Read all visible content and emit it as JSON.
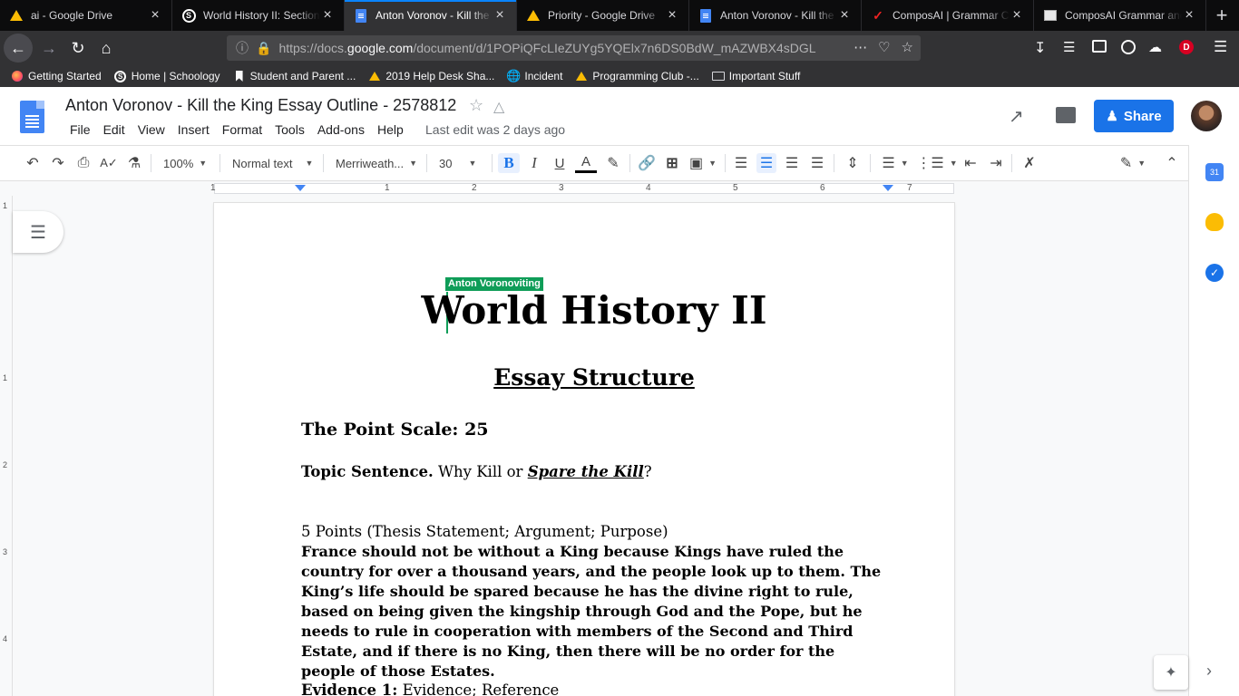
{
  "browser": {
    "tabs": [
      {
        "title": "ai - Google Drive",
        "icon": "google-drive-icon",
        "active": false
      },
      {
        "title": "World History II: Section",
        "icon": "schoology-icon",
        "active": false
      },
      {
        "title": "Anton Voronov - Kill the",
        "icon": "google-docs-icon",
        "active": true
      },
      {
        "title": "Priority - Google Drive",
        "icon": "google-drive-icon",
        "active": false
      },
      {
        "title": "Anton Voronov - Kill the",
        "icon": "google-docs-icon",
        "active": false
      },
      {
        "title": "ComposAI | Grammar Ch",
        "icon": "composai-icon",
        "active": false
      },
      {
        "title": "ComposAI Grammar and",
        "icon": "image-icon",
        "active": false
      }
    ],
    "url_prefix": "https://docs.",
    "url_host": "google.com",
    "url_path": "/document/d/1POPiQFcLIeZUYg5YQElx7n6DS0BdW_mAZWBX4sDGL",
    "bookmarks": [
      {
        "label": "Getting Started",
        "icon": "firefox-icon"
      },
      {
        "label": "Home | Schoology",
        "icon": "schoology-icon"
      },
      {
        "label": "Student and Parent ...",
        "icon": "bookmark-icon"
      },
      {
        "label": "2019 Help Desk Sha...",
        "icon": "google-drive-icon"
      },
      {
        "label": "Incident",
        "icon": "globe-icon"
      },
      {
        "label": "Programming Club -...",
        "icon": "google-drive-icon"
      },
      {
        "label": "Important Stuff",
        "icon": "folder-icon"
      }
    ],
    "profile_initial": "D"
  },
  "docs": {
    "title": "Anton Voronov - Kill the King Essay Outline - 2578812",
    "menu": [
      "File",
      "Edit",
      "View",
      "Insert",
      "Format",
      "Tools",
      "Add-ons",
      "Help"
    ],
    "last_edit": "Last edit was 2 days ago",
    "share_label": "Share",
    "toolbar": {
      "zoom": "100%",
      "style": "Normal text",
      "font": "Merriweath...",
      "size": "30"
    },
    "ruler_numbers": [
      "1",
      "1",
      "2",
      "3",
      "4",
      "5",
      "6",
      "7"
    ],
    "vruler_numbers": [
      "1",
      "1",
      "2",
      "3",
      "4"
    ]
  },
  "document": {
    "cursor_user": "Anton Voronov",
    "cursor_suffix": "iting",
    "title": "World History II",
    "subtitle": "Essay Structure",
    "point_scale": "The Point Scale: 25",
    "topic_label": "Topic Sentence.",
    "topic_text": " Why Kill or ",
    "topic_emph": "Spare the Kill",
    "topic_end": "?",
    "points_line": "5 Points (Thesis Statement; Argument; Purpose)",
    "thesis": "France should not be without a King because Kings have ruled the country for over a thousand years, and the people look up to them. The King’s life should be spared because  he has the divine right to rule, based on being given the kingship through God and the Pope, but he needs to rule in cooperation with members of the Second and Third Estate, and if there is no King, then there will be no order for the people of those Estates.",
    "evidence_label": "Evidence 1:",
    "evidence_text": " Evidence; Reference"
  },
  "colors": {
    "accent": "#1a73e8",
    "tab_active_indicator": "#0a84ff",
    "collaborator": "#0f9d58"
  }
}
